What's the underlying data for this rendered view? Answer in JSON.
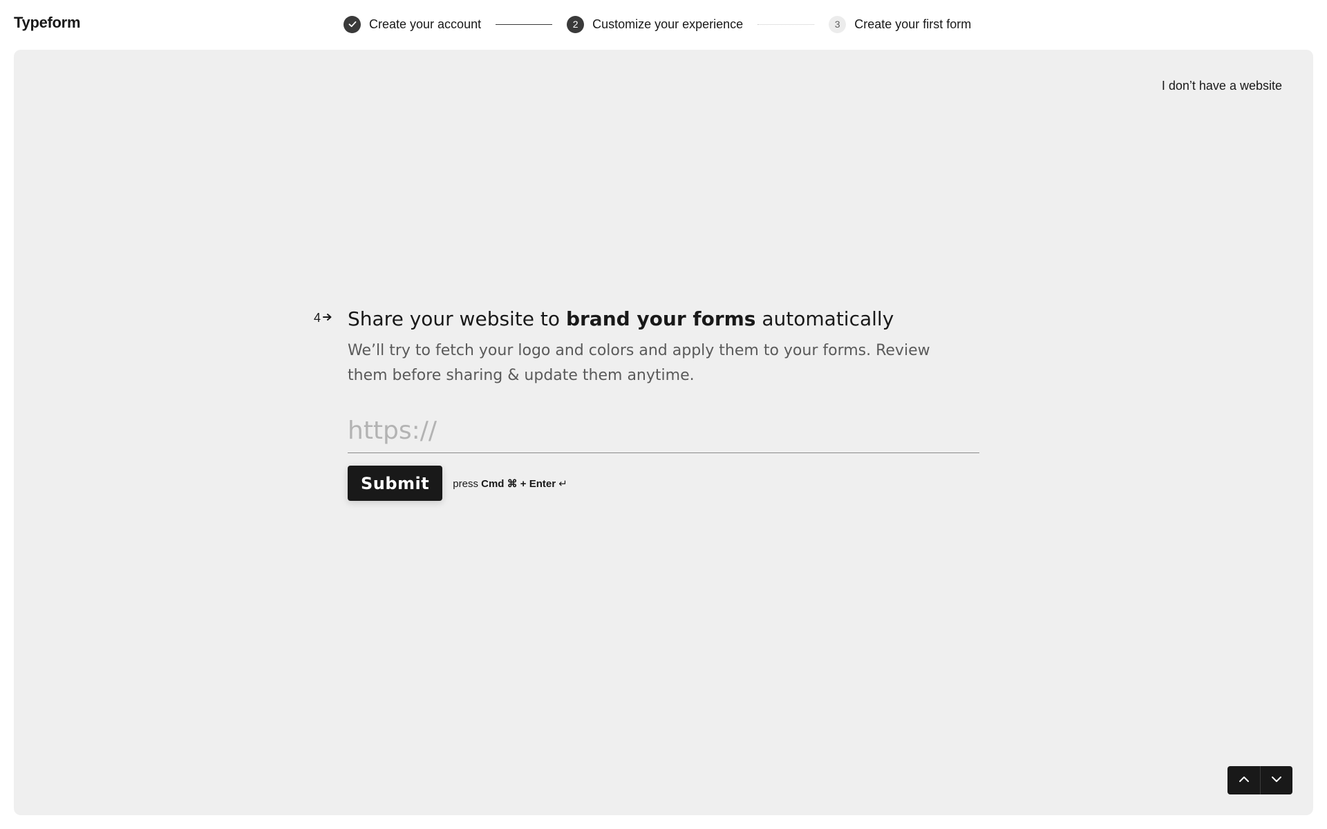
{
  "header": {
    "logo": "Typeform",
    "steps": [
      {
        "label": "Create your account",
        "status": "done"
      },
      {
        "number": "2",
        "label": "Customize your experience",
        "status": "active"
      },
      {
        "number": "3",
        "label": "Create your first form",
        "status": "todo"
      }
    ]
  },
  "panel": {
    "skip_link": "I don’t have a website",
    "question": {
      "number": "4",
      "title_start": "Share your website to ",
      "title_bold": "brand your forms",
      "title_end": " automatically",
      "description": "We’ll try to fetch your logo and colors and apply them to your forms. Review them before sharing & update them anytime.",
      "input_placeholder": "https://",
      "input_value": "",
      "submit_label": "Submit",
      "hint_press": "press",
      "hint_keys": "Cmd ⌘ + Enter",
      "hint_symbol": "↵"
    }
  },
  "icons": {
    "step_done": "check-icon",
    "question_arrow": "arrow-right-icon",
    "nav_up": "chevron-up-icon",
    "nav_down": "chevron-down-icon"
  },
  "colors": {
    "panel_bg": "#efefef",
    "button_bg": "#191919",
    "text": "#191919"
  }
}
